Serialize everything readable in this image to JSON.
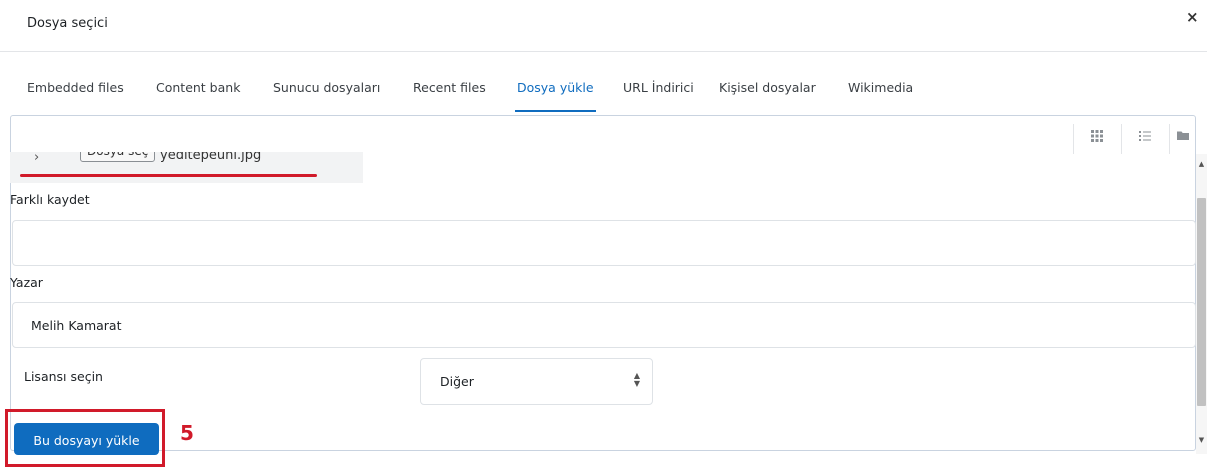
{
  "dialog": {
    "title": "Dosya seçici",
    "close_icon": "×"
  },
  "tabs": [
    {
      "label": "Embedded files"
    },
    {
      "label": "Content bank"
    },
    {
      "label": "Sunucu dosyaları"
    },
    {
      "label": "Recent files"
    },
    {
      "label": "Dosya yükle",
      "active": true
    },
    {
      "label": "URL İndirici"
    },
    {
      "label": "Kişisel dosyalar"
    },
    {
      "label": "Wikimedia"
    }
  ],
  "view_toolbar": {
    "icons": [
      "grid-view-icon",
      "list-view-icon",
      "folder-view-icon"
    ]
  },
  "file_picker": {
    "button_label": "Dosya seç",
    "file_name": "yeditepeuni.jpg"
  },
  "form": {
    "save_as_label": "Farklı kaydet",
    "save_as_value": "",
    "author_label": "Yazar",
    "author_value": "Melih Kamarat",
    "license_label": "Lisansı seçin",
    "license_value": "Diğer"
  },
  "actions": {
    "upload_label": "Bu dosyayı yükle"
  },
  "annotation": {
    "step_number": "5",
    "color": "#d11a2a"
  },
  "colors": {
    "accent": "#0f6cbf",
    "annotation_red": "#d11a2a"
  }
}
